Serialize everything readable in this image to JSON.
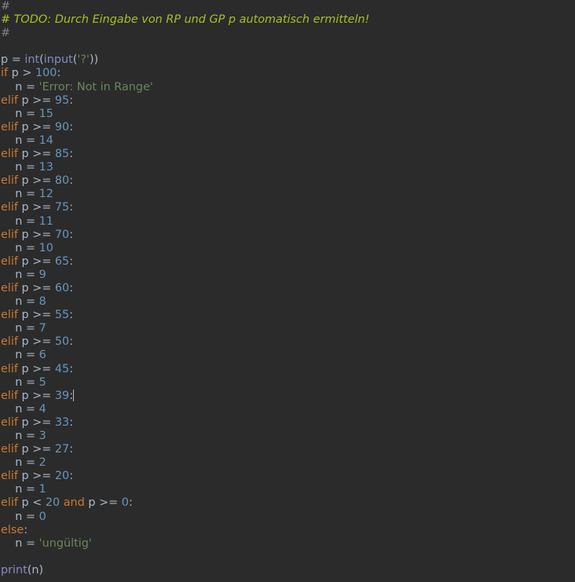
{
  "editor": {
    "lines": [
      [
        {
          "t": "#",
          "c": "comment"
        }
      ],
      [
        {
          "t": "# TODO: Durch Eingabe von RP und GP p automatisch ermitteln!",
          "c": "todo"
        }
      ],
      [
        {
          "t": "#",
          "c": "comment"
        }
      ],
      [],
      [
        {
          "t": "p = ",
          "c": "ident"
        },
        {
          "t": "int",
          "c": "builtin"
        },
        {
          "t": "(",
          "c": "ident"
        },
        {
          "t": "input",
          "c": "builtin"
        },
        {
          "t": "(",
          "c": "ident"
        },
        {
          "t": "'?'",
          "c": "str"
        },
        {
          "t": "))",
          "c": "ident"
        }
      ],
      [
        {
          "t": "if",
          "c": "kw"
        },
        {
          "t": " p > ",
          "c": "ident"
        },
        {
          "t": "100",
          "c": "num"
        },
        {
          "t": ":",
          "c": "ident"
        }
      ],
      [
        {
          "t": "    n = ",
          "c": "ident"
        },
        {
          "t": "'Error: Not in Range'",
          "c": "str"
        }
      ],
      [
        {
          "t": "elif",
          "c": "kw"
        },
        {
          "t": " p >= ",
          "c": "ident"
        },
        {
          "t": "95",
          "c": "num"
        },
        {
          "t": ":",
          "c": "ident"
        }
      ],
      [
        {
          "t": "    n = ",
          "c": "ident"
        },
        {
          "t": "15",
          "c": "num"
        }
      ],
      [
        {
          "t": "elif",
          "c": "kw"
        },
        {
          "t": " p >= ",
          "c": "ident"
        },
        {
          "t": "90",
          "c": "num"
        },
        {
          "t": ":",
          "c": "ident"
        }
      ],
      [
        {
          "t": "    n = ",
          "c": "ident"
        },
        {
          "t": "14",
          "c": "num"
        }
      ],
      [
        {
          "t": "elif",
          "c": "kw"
        },
        {
          "t": " p >= ",
          "c": "ident"
        },
        {
          "t": "85",
          "c": "num"
        },
        {
          "t": ":",
          "c": "ident"
        }
      ],
      [
        {
          "t": "    n = ",
          "c": "ident"
        },
        {
          "t": "13",
          "c": "num"
        }
      ],
      [
        {
          "t": "elif",
          "c": "kw"
        },
        {
          "t": " p >= ",
          "c": "ident"
        },
        {
          "t": "80",
          "c": "num"
        },
        {
          "t": ":",
          "c": "ident"
        }
      ],
      [
        {
          "t": "    n = ",
          "c": "ident"
        },
        {
          "t": "12",
          "c": "num"
        }
      ],
      [
        {
          "t": "elif",
          "c": "kw"
        },
        {
          "t": " p >= ",
          "c": "ident"
        },
        {
          "t": "75",
          "c": "num"
        },
        {
          "t": ":",
          "c": "ident"
        }
      ],
      [
        {
          "t": "    n = ",
          "c": "ident"
        },
        {
          "t": "11",
          "c": "num"
        }
      ],
      [
        {
          "t": "elif",
          "c": "kw"
        },
        {
          "t": " p >= ",
          "c": "ident"
        },
        {
          "t": "70",
          "c": "num"
        },
        {
          "t": ":",
          "c": "ident"
        }
      ],
      [
        {
          "t": "    n = ",
          "c": "ident"
        },
        {
          "t": "10",
          "c": "num"
        }
      ],
      [
        {
          "t": "elif",
          "c": "kw"
        },
        {
          "t": " p >= ",
          "c": "ident"
        },
        {
          "t": "65",
          "c": "num"
        },
        {
          "t": ":",
          "c": "ident"
        }
      ],
      [
        {
          "t": "    n = ",
          "c": "ident"
        },
        {
          "t": "9",
          "c": "num"
        }
      ],
      [
        {
          "t": "elif",
          "c": "kw"
        },
        {
          "t": " p >= ",
          "c": "ident"
        },
        {
          "t": "60",
          "c": "num"
        },
        {
          "t": ":",
          "c": "ident"
        }
      ],
      [
        {
          "t": "    n = ",
          "c": "ident"
        },
        {
          "t": "8",
          "c": "num"
        }
      ],
      [
        {
          "t": "elif",
          "c": "kw"
        },
        {
          "t": " p >= ",
          "c": "ident"
        },
        {
          "t": "55",
          "c": "num"
        },
        {
          "t": ":",
          "c": "ident"
        }
      ],
      [
        {
          "t": "    n = ",
          "c": "ident"
        },
        {
          "t": "7",
          "c": "num"
        }
      ],
      [
        {
          "t": "elif",
          "c": "kw"
        },
        {
          "t": " p >= ",
          "c": "ident"
        },
        {
          "t": "50",
          "c": "num"
        },
        {
          "t": ":",
          "c": "ident"
        }
      ],
      [
        {
          "t": "    n = ",
          "c": "ident"
        },
        {
          "t": "6",
          "c": "num"
        }
      ],
      [
        {
          "t": "elif",
          "c": "kw"
        },
        {
          "t": " p >= ",
          "c": "ident"
        },
        {
          "t": "45",
          "c": "num"
        },
        {
          "t": ":",
          "c": "ident"
        }
      ],
      [
        {
          "t": "    n = ",
          "c": "ident"
        },
        {
          "t": "5",
          "c": "num"
        }
      ],
      [
        {
          "t": "elif",
          "c": "kw"
        },
        {
          "t": " p >= ",
          "c": "ident"
        },
        {
          "t": "39",
          "c": "num"
        },
        {
          "t": ":",
          "c": "ident"
        },
        {
          "t": "",
          "c": "cursor"
        }
      ],
      [
        {
          "t": "    n = ",
          "c": "ident"
        },
        {
          "t": "4",
          "c": "num"
        }
      ],
      [
        {
          "t": "elif",
          "c": "kw"
        },
        {
          "t": " p >= ",
          "c": "ident"
        },
        {
          "t": "33",
          "c": "num"
        },
        {
          "t": ":",
          "c": "ident"
        }
      ],
      [
        {
          "t": "    n = ",
          "c": "ident"
        },
        {
          "t": "3",
          "c": "num"
        }
      ],
      [
        {
          "t": "elif",
          "c": "kw"
        },
        {
          "t": " p >= ",
          "c": "ident"
        },
        {
          "t": "27",
          "c": "num"
        },
        {
          "t": ":",
          "c": "ident"
        }
      ],
      [
        {
          "t": "    n = ",
          "c": "ident"
        },
        {
          "t": "2",
          "c": "num"
        }
      ],
      [
        {
          "t": "elif",
          "c": "kw"
        },
        {
          "t": " p >= ",
          "c": "ident"
        },
        {
          "t": "20",
          "c": "num"
        },
        {
          "t": ":",
          "c": "ident"
        }
      ],
      [
        {
          "t": "    n = ",
          "c": "ident"
        },
        {
          "t": "1",
          "c": "num"
        }
      ],
      [
        {
          "t": "elif",
          "c": "kw"
        },
        {
          "t": " p < ",
          "c": "ident"
        },
        {
          "t": "20",
          "c": "num"
        },
        {
          "t": " ",
          "c": "ident"
        },
        {
          "t": "and",
          "c": "kw"
        },
        {
          "t": " p >= ",
          "c": "ident"
        },
        {
          "t": "0",
          "c": "num"
        },
        {
          "t": ":",
          "c": "ident"
        }
      ],
      [
        {
          "t": "    n = ",
          "c": "ident"
        },
        {
          "t": "0",
          "c": "num"
        }
      ],
      [
        {
          "t": "else",
          "c": "kw"
        },
        {
          "t": ":",
          "c": "ident"
        }
      ],
      [
        {
          "t": "    n = ",
          "c": "ident"
        },
        {
          "t": "'ungültig'",
          "c": "str"
        }
      ],
      [],
      [
        {
          "t": "print",
          "c": "builtin"
        },
        {
          "t": "(n)",
          "c": "ident"
        }
      ]
    ]
  },
  "colors": {
    "background": "#2b2b2b",
    "default_text": "#a9b7c6",
    "comment": "#808080",
    "todo": "#a8c023",
    "keyword": "#cc7832",
    "number": "#6897bb",
    "string": "#6a8759",
    "builtin": "#8888c6"
  }
}
